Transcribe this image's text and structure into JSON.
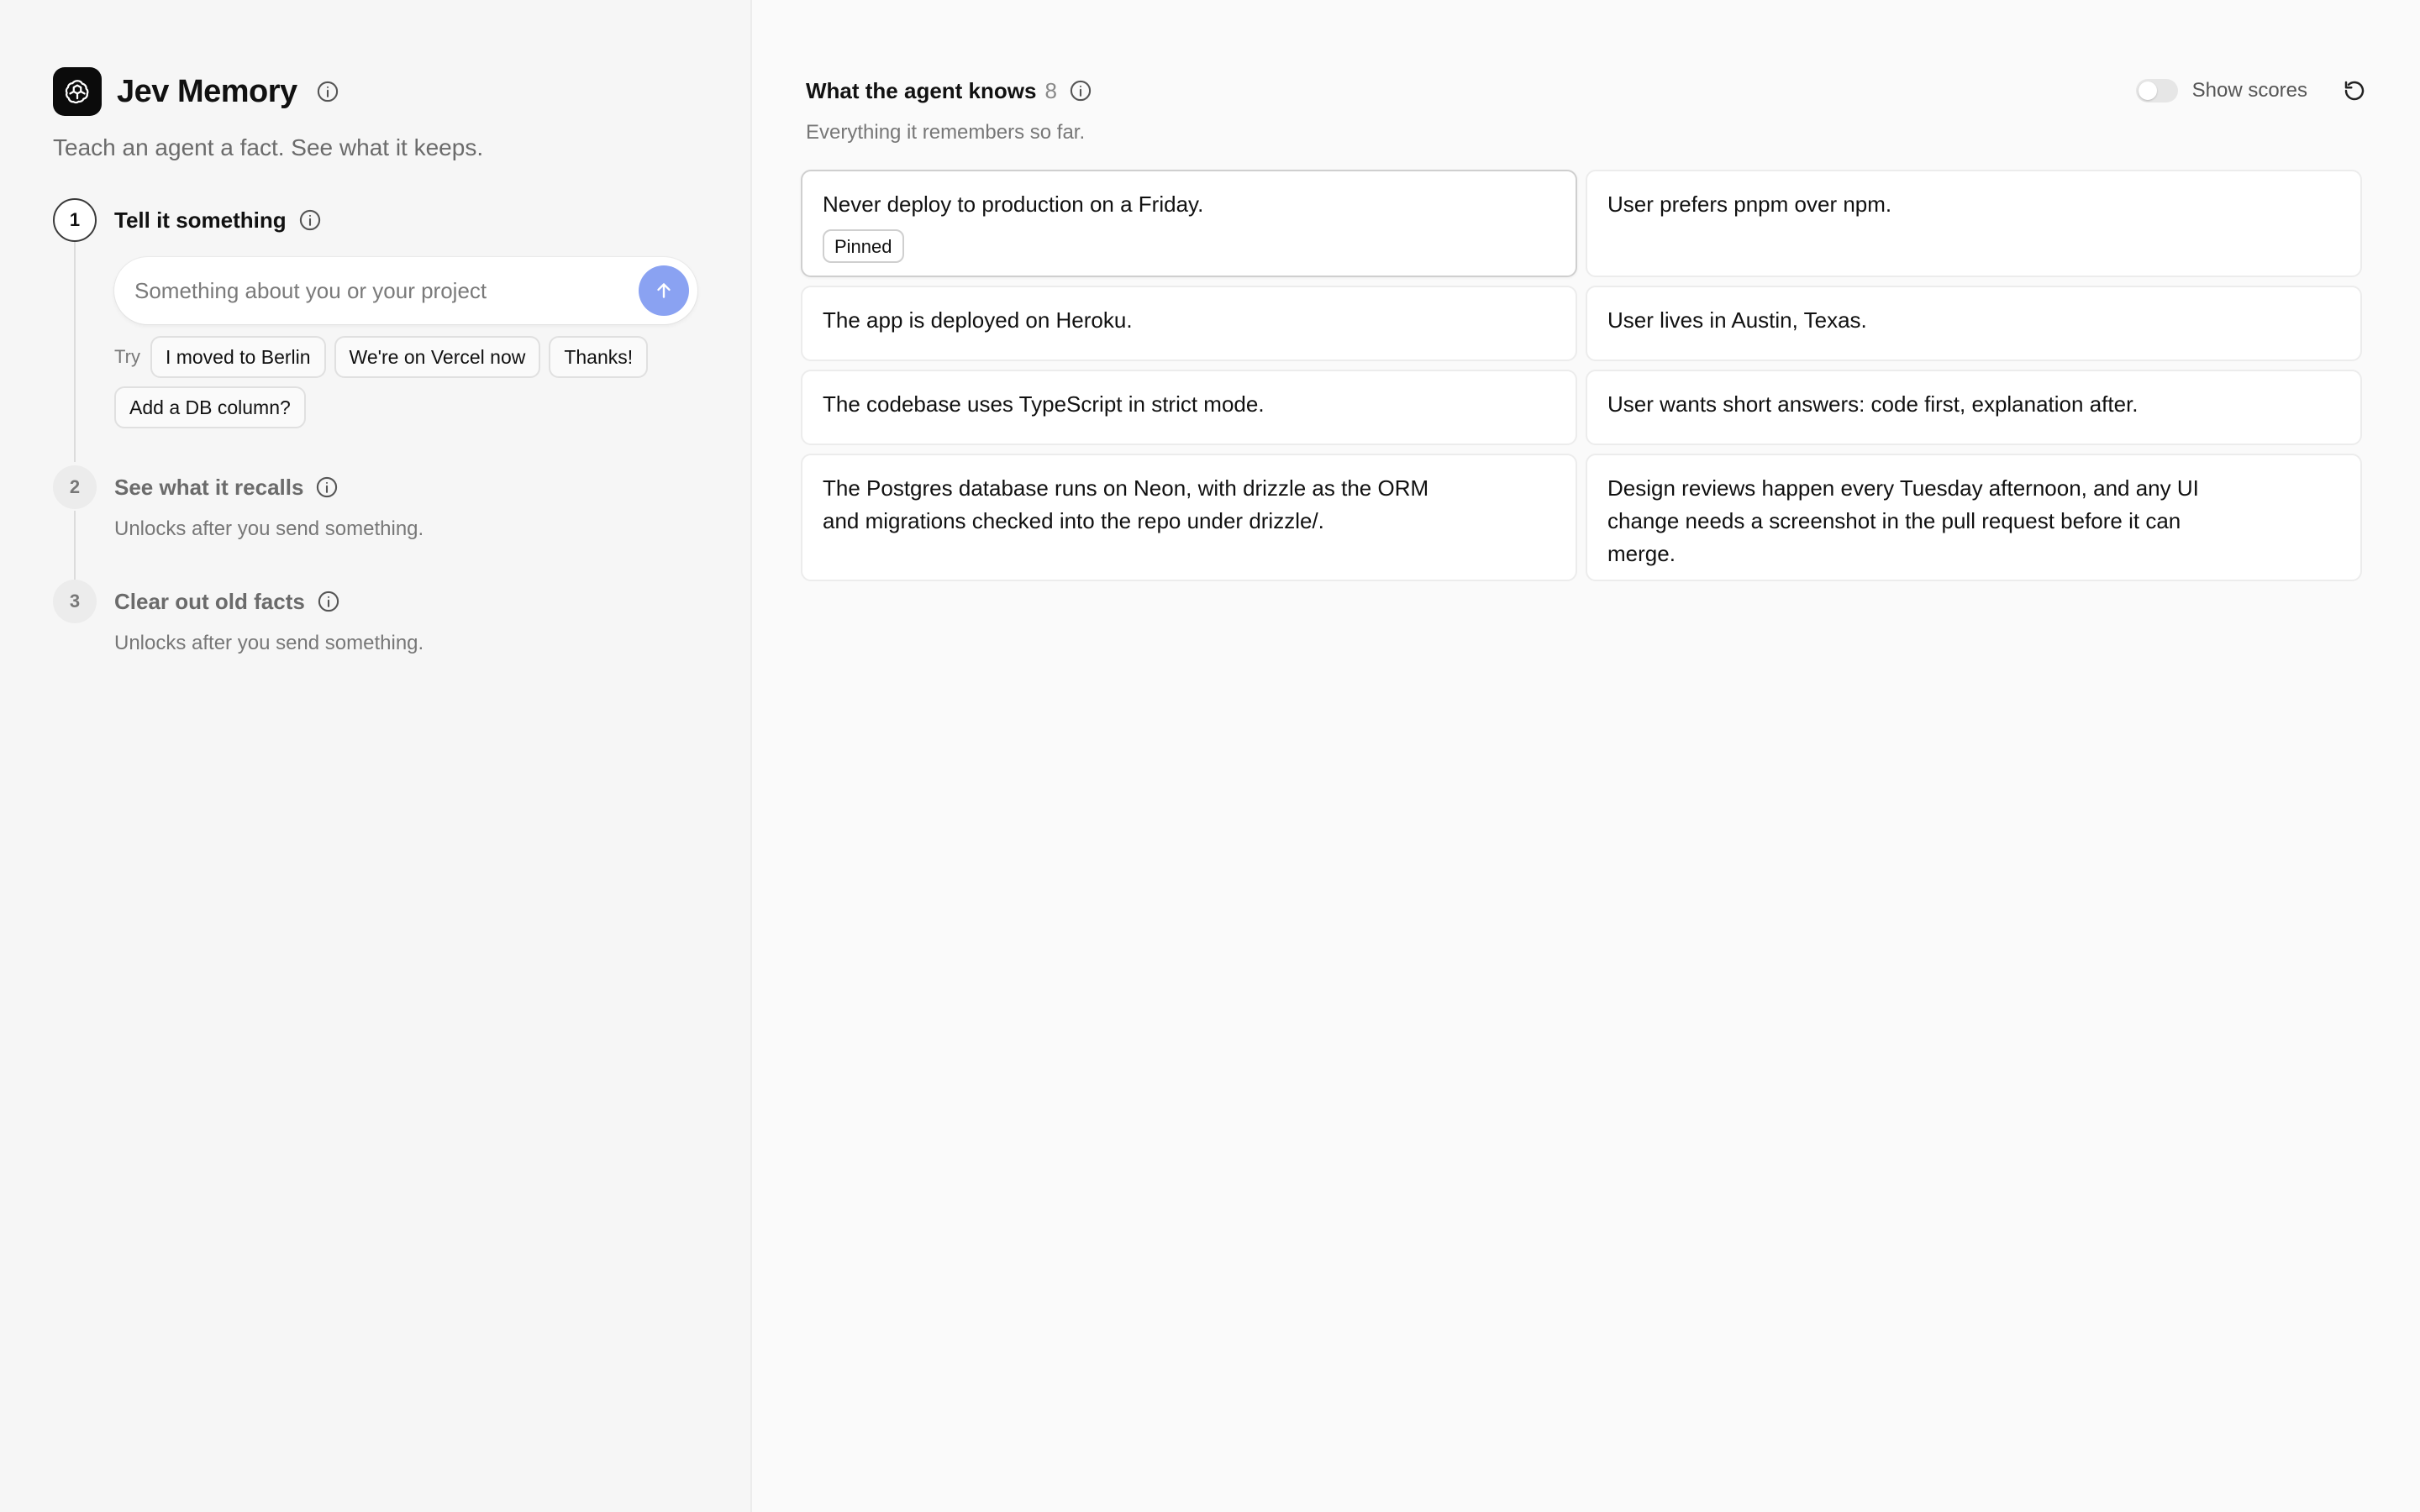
{
  "brand": {
    "title": "Jev Memory",
    "tagline": "Teach an agent a fact. See what it keeps."
  },
  "steps": [
    {
      "number": "1",
      "title": "Tell it something",
      "state": "active"
    },
    {
      "number": "2",
      "title": "See what it recalls",
      "subtitle": "Unlocks after you send something.",
      "state": "locked"
    },
    {
      "number": "3",
      "title": "Clear out old facts",
      "subtitle": "Unlocks after you send something.",
      "state": "locked"
    }
  ],
  "compose": {
    "placeholder": "Something about you or your project",
    "value": ""
  },
  "suggestions": {
    "label": "Try",
    "chips": [
      "I moved to Berlin",
      "We're on Vercel now",
      "Thanks!",
      "Add a DB column?"
    ]
  },
  "memory": {
    "title": "What the agent knows",
    "count": "8",
    "subtitle": "Everything it remembers so far.",
    "show_scores_label": "Show scores",
    "show_scores_on": false,
    "facts": [
      {
        "text": "Never deploy to production on a Friday.",
        "badge": "Pinned"
      },
      {
        "text": "User prefers pnpm over npm."
      },
      {
        "text": "The app is deployed on Heroku."
      },
      {
        "text": "User lives in Austin, Texas."
      },
      {
        "text": "The codebase uses TypeScript in strict mode."
      },
      {
        "text": "User wants short answers: code first, explanation after."
      },
      {
        "text": "The Postgres database runs on Neon, with drizzle as the ORM and migrations checked into the repo under drizzle/."
      },
      {
        "text": "Design reviews happen every Tuesday afternoon, and any UI change needs a screenshot in the pull request before it can merge."
      }
    ]
  },
  "colors": {
    "accent": "#8aa2f2",
    "sidebar_bg": "#f6f6f6",
    "main_bg": "#fafafa"
  }
}
